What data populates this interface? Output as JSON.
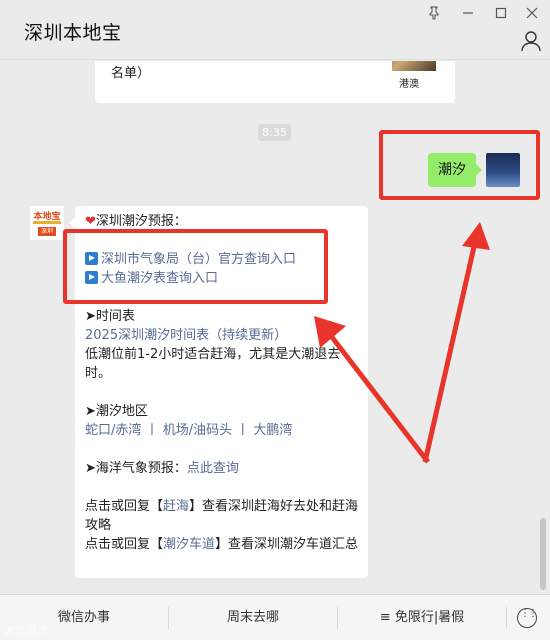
{
  "window": {
    "title": "深圳本地宝",
    "pin_icon": "pin-icon",
    "minimize_icon": "minimize-icon",
    "maximize_icon": "maximize-icon",
    "close_icon": "close-icon",
    "profile_icon": "person-icon"
  },
  "chat": {
    "prev_card": {
      "text": "名单）",
      "thumb_label": "港澳"
    },
    "time": "8:35",
    "user_message": "潮汐",
    "reply": {
      "heading": "深圳潮汐预报：",
      "link1": "深圳市气象局（台）官方查询入口",
      "link2": "大鱼潮汐表查询入口",
      "section1_title": "➤时间表",
      "section1_link": "2025深圳潮汐时间表（持续更新）",
      "section1_text": "低潮位前1-2小时适合赶海，尤其是大潮退去时。",
      "section2_title": "➤潮汐地区",
      "section2_links": [
        "蛇口/赤湾",
        "机场/油码头",
        "大鹏湾"
      ],
      "section2_sep": "丨",
      "section3_prefix": "➤海洋气象预报：",
      "section3_link": "点此查询",
      "footer1_pre": "点击或回复【",
      "footer1_link": "赶海",
      "footer1_post": "】查看深圳赶海好去处和赶海攻略",
      "footer2_pre": "点击或回复【",
      "footer2_link": "潮汐车道",
      "footer2_post": "】查看深圳潮汐车道汇总"
    },
    "bot_avatar": {
      "line1": "本地宝",
      "line2": "深圳"
    }
  },
  "bottom_menu": {
    "items": [
      "微信办事",
      "周末去哪",
      "≡ 免限行|暑假"
    ],
    "keyboard_icon": "keyboard-icon"
  },
  "watermark": "大鱼潮汐",
  "colors": {
    "link": "#576b95",
    "bubble": "#95ec69",
    "annotation": "#e8342a"
  }
}
